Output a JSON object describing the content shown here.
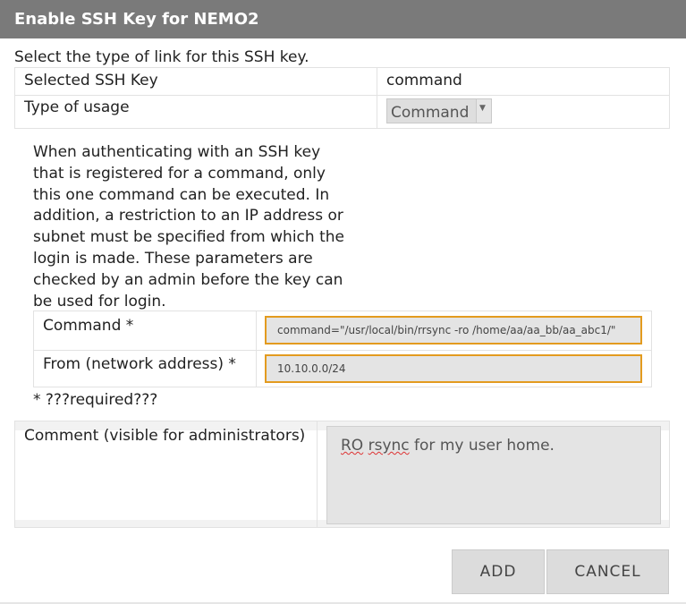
{
  "dialog": {
    "title": "Enable SSH Key for NEMO2",
    "intro": "Select the type of link for this SSH key."
  },
  "key_table": {
    "selected_key_label": "Selected SSH Key",
    "selected_key_value": "command",
    "usage_label": "Type of usage",
    "usage_value": "Command"
  },
  "description": "When authenticating with an SSH key that is registered for a command, only this one command can be executed. In addition, a restriction to an IP address or subnet must be specified from which the login is made. These parameters are checked by an admin before the key can be used for login.",
  "params": {
    "command_label": "Command *",
    "command_value": "command=\"/usr/local/bin/rrsync -ro /home/aa/aa_bb/aa_abc1/\"",
    "from_label": "From (network address) *",
    "from_value": "10.10.0.0/24",
    "required_note": "* ???required???"
  },
  "comment": {
    "label": "Comment (visible for administrators)",
    "text_word1": "RO",
    "text_word2": "rsync",
    "text_rest": " for my user home."
  },
  "buttons": {
    "add": "ADD",
    "cancel": "CANCEL"
  },
  "colors": {
    "titlebar": "#7a7a7a",
    "input_focus_border": "#e39b1f",
    "button_bg": "#dcdcdc"
  }
}
